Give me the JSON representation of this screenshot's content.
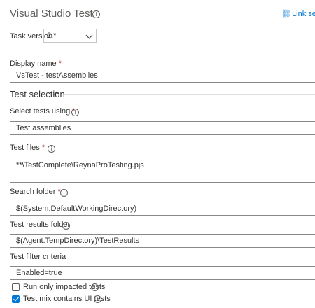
{
  "header": {
    "title": "Visual Studio Test",
    "info_icon": "info-icon",
    "link_settings": "Link sett",
    "link_icon": "link-icon"
  },
  "task_version": {
    "label": "Task version",
    "value": "2.*"
  },
  "display_name": {
    "label": "Display name",
    "required": "*",
    "value": "VsTest - testAssemblies"
  },
  "test_selection": {
    "title": "Test selection",
    "expanded": true
  },
  "select_tests_using": {
    "label": "Select tests using",
    "required": "*",
    "value": "Test assemblies"
  },
  "test_files": {
    "label": "Test files",
    "required": "*",
    "value": "**\\TestComplete\\ReynaProTesting.pjs"
  },
  "search_folder": {
    "label": "Search folder",
    "required": "*",
    "value": "$(System.DefaultWorkingDirectory)"
  },
  "test_results_folder": {
    "label": "Test results folder",
    "value": "$(Agent.TempDirectory)\\TestResults"
  },
  "test_filter_criteria": {
    "label": "Test filter criteria",
    "value": "Enabled=true"
  },
  "options": [
    {
      "label": "Run only impacted tests",
      "checked": false
    },
    {
      "label": "Test mix contains UI tests",
      "checked": true
    }
  ],
  "colors": {
    "accent": "#0078d4",
    "required": "#a4262c"
  }
}
